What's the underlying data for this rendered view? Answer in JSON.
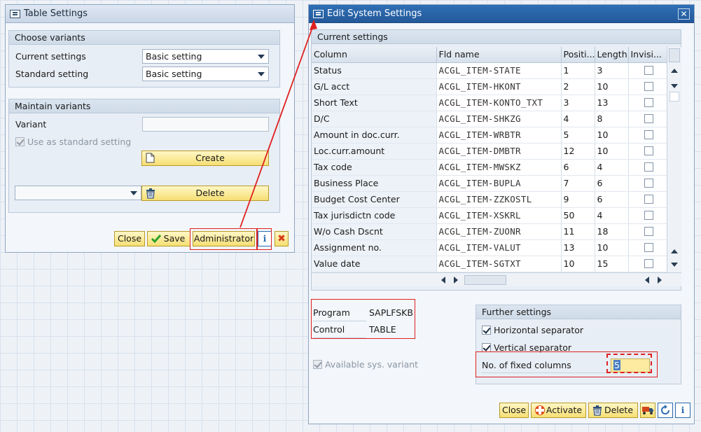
{
  "table_settings": {
    "title": "Table Settings",
    "choose_variants": {
      "header": "Choose variants",
      "current_label": "Current settings",
      "current_value": "Basic setting",
      "standard_label": "Standard setting",
      "standard_value": "Basic setting"
    },
    "maintain_variants": {
      "header": "Maintain variants",
      "variant_label": "Variant",
      "variant_value": "",
      "use_std_label": "Use as standard setting",
      "create_label": "Create",
      "delete_label": "Delete"
    },
    "footer": {
      "close": "Close",
      "save": "Save",
      "administrator": "Administrator"
    }
  },
  "system_settings": {
    "title": "Edit System Settings",
    "current_header": "Current settings",
    "columns": [
      "Column",
      "Fld name",
      "Positi...",
      "Length",
      "Invisi..."
    ],
    "rows": [
      {
        "column": "Status",
        "fld": "ACGL_ITEM-STATE",
        "pos": "1",
        "len": "3"
      },
      {
        "column": "G/L acct",
        "fld": "ACGL_ITEM-HKONT",
        "pos": "2",
        "len": "10"
      },
      {
        "column": "Short Text",
        "fld": "ACGL_ITEM-KONTO_TXT",
        "pos": "3",
        "len": "13"
      },
      {
        "column": "D/C",
        "fld": "ACGL_ITEM-SHKZG",
        "pos": "4",
        "len": "8"
      },
      {
        "column": "Amount in doc.curr.",
        "fld": "ACGL_ITEM-WRBTR",
        "pos": "5",
        "len": "10"
      },
      {
        "column": "Loc.curr.amount",
        "fld": "ACGL_ITEM-DMBTR",
        "pos": "12",
        "len": "10"
      },
      {
        "column": "Tax code",
        "fld": "ACGL_ITEM-MWSKZ",
        "pos": "6",
        "len": "4"
      },
      {
        "column": "Business Place",
        "fld": "ACGL_ITEM-BUPLA",
        "pos": "7",
        "len": "6"
      },
      {
        "column": "Budget Cost Center",
        "fld": "ACGL_ITEM-ZZKOSTL",
        "pos": "9",
        "len": "6"
      },
      {
        "column": "Tax jurisdictn code",
        "fld": "ACGL_ITEM-XSKRL",
        "pos": "50",
        "len": "4"
      },
      {
        "column": "W/o Cash Dscnt",
        "fld": "ACGL_ITEM-ZUONR",
        "pos": "11",
        "len": "18"
      },
      {
        "column": "Assignment no.",
        "fld": "ACGL_ITEM-VALUT",
        "pos": "13",
        "len": "10"
      },
      {
        "column": "Value date",
        "fld": "ACGL_ITEM-SGTXT",
        "pos": "10",
        "len": "15"
      }
    ],
    "program_label": "Program",
    "program_value": "SAPLFSKB",
    "control_label": "Control",
    "control_value": "TABLE",
    "available_sys_variant": "Available sys. variant",
    "further": {
      "header": "Further settings",
      "horizontal": "Horizontal separator",
      "vertical": "Vertical separator",
      "fixed_label": "No. of fixed columns",
      "fixed_value": "5"
    },
    "footer": {
      "close": "Close",
      "activate": "Activate",
      "delete": "Delete"
    }
  },
  "colors": {
    "accent_red": "#e02020",
    "button_yellow": "#f6df73",
    "title_blue": "#2f6fb5"
  }
}
